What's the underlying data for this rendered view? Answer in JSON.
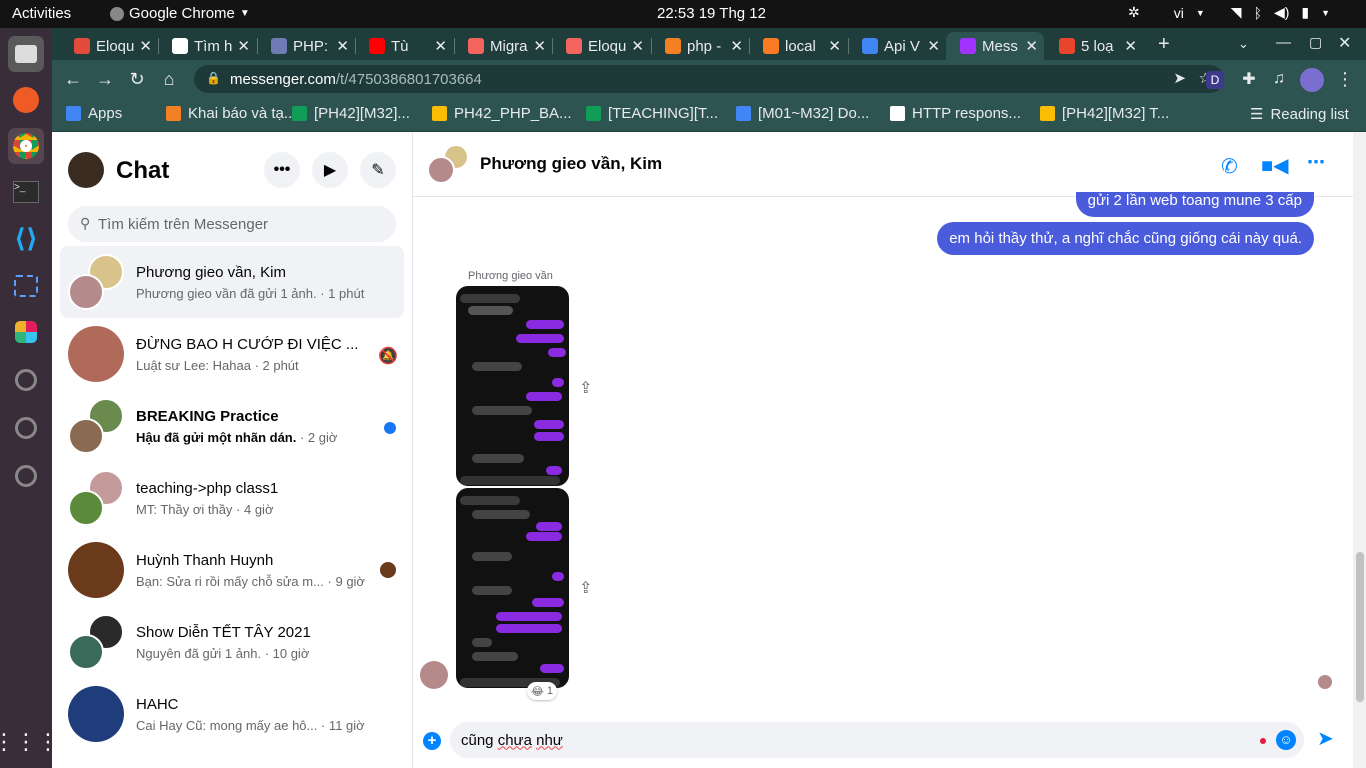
{
  "os": {
    "activities": "Activities",
    "app_name": "Google Chrome",
    "clock": "22:53  19 Thg 12",
    "lang": "vi"
  },
  "browser": {
    "tabs": [
      {
        "label": "Eloqu",
        "icon": "eloquent-icon",
        "color": "#e24b3b"
      },
      {
        "label": "Tìm h",
        "icon": "globe-icon",
        "color": "#ffffff"
      },
      {
        "label": "PHP:",
        "icon": "php-icon",
        "color": "#6e7bb5"
      },
      {
        "label": "Tù",
        "icon": "youtube-icon",
        "color": "#ff0000"
      },
      {
        "label": "Migra",
        "icon": "laravel-icon",
        "color": "#f4645f"
      },
      {
        "label": "Eloqu",
        "icon": "laravel-icon",
        "color": "#f4645f"
      },
      {
        "label": "php -",
        "icon": "stackoverflow-icon",
        "color": "#f48024"
      },
      {
        "label": "local",
        "icon": "xampp-icon",
        "color": "#fb7a24"
      },
      {
        "label": "Api V",
        "icon": "api-icon",
        "color": "#4285f4"
      },
      {
        "label": "Mess",
        "icon": "messenger-icon",
        "color": "#a033ff"
      },
      {
        "label": "5 loạ",
        "icon": "site-icon",
        "color": "#e8462b"
      }
    ],
    "url_host": "messenger.com",
    "url_path": "/t/4750386801703664",
    "bookmarks": [
      {
        "label": "Apps",
        "color": "#4285f4"
      },
      {
        "label": "Khai báo và tạ...",
        "color": "#f48024"
      },
      {
        "label": "[PH42][M32]...",
        "color": "#0f9d58"
      },
      {
        "label": "PH42_PHP_BA...",
        "color": "#fbbc04"
      },
      {
        "label": "[TEACHING][T...",
        "color": "#0f9d58"
      },
      {
        "label": "[M01~M32] Do...",
        "color": "#4285f4"
      },
      {
        "label": "HTTP respons...",
        "color": "#ffffff"
      },
      {
        "label": "[PH42][M32] T...",
        "color": "#fbbc04"
      }
    ],
    "reading_list": "Reading list",
    "profile_letter": "D"
  },
  "sidebar": {
    "title": "Chat",
    "search_placeholder": "Tìm kiếm trên Messenger",
    "conversations": [
      {
        "name": "Phương gieo vần, Kim",
        "preview": "Phương gieo vần đã gửi 1 ảnh.",
        "time": "· 1 phút",
        "c1": "#d8c48a",
        "c2": "#b58a8a"
      },
      {
        "name": "ĐỪNG BAO H CƯỚP ĐI VIỆC ...",
        "preview": "Luật sư Lee: Hahaa",
        "time": "· 2 phút",
        "c1": "#b06a5a",
        "c2": "#b06a5a"
      },
      {
        "name": "BREAKING Practice",
        "preview": "Hậu đã gửi một nhãn dán.",
        "time": "· 2 giờ",
        "c1": "#6b8a4e",
        "c2": "#8a6a50"
      },
      {
        "name": "teaching->php class1",
        "preview": "MT: Thầy ơi thầy",
        "time": "· 4 giờ",
        "c1": "#c49a9a",
        "c2": "#5a8a3a"
      },
      {
        "name": "Huỳnh Thanh Huynh",
        "preview": "Bạn: Sửa ri rồi mấy chỗ sửa m...",
        "time": "· 9 giờ",
        "c1": "#6b3a1a",
        "c2": "#6b3a1a"
      },
      {
        "name": "Show Diễn TẾT TÂY 2021",
        "preview": "Nguyên đã gửi 1 ảnh.",
        "time": "· 10 giờ",
        "c1": "#2a2a2a",
        "c2": "#3a6a5a"
      },
      {
        "name": "HAHC",
        "preview": "Cai Hay Cũ: mong mấy ae hô...",
        "time": "· 11 giờ",
        "c1": "#1e3d7a",
        "c2": "#1e3d7a"
      }
    ]
  },
  "chat": {
    "title": "Phương gieo vần, Kim",
    "messages_out": [
      {
        "text": "gửi 2 lần web toang mune 3 cấp"
      },
      {
        "text": "em hỏi thầy thử, a nghĩ chắc cũng giống cái này quá."
      }
    ],
    "sender_label": "Phương gieo vần",
    "reaction_emoji": "😂",
    "reaction_count": "1",
    "composer_value": "cũng chưa như"
  }
}
